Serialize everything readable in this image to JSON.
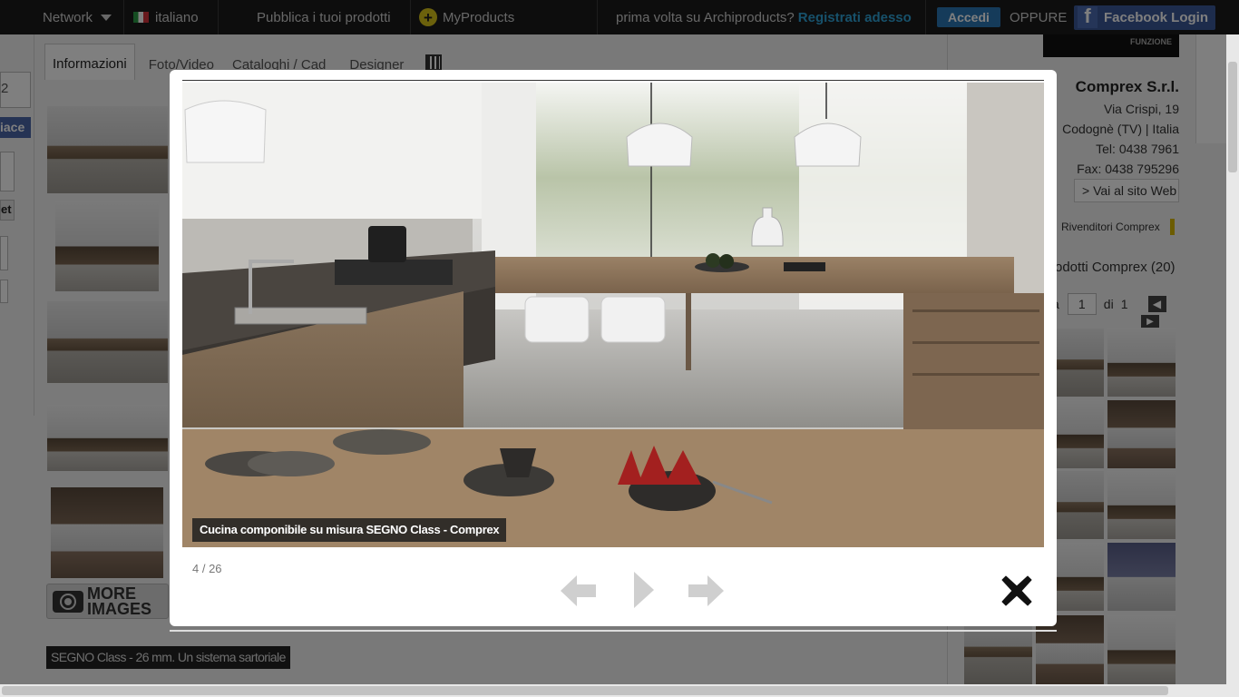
{
  "topbar": {
    "network": "Network",
    "language": "italiano",
    "publish": "Pubblica i tuoi prodotti",
    "myproducts": "MyProducts",
    "first_time": "prima volta su Archiproducts?",
    "register": "Registrati adesso",
    "login": "Accedi",
    "or": "OPPURE",
    "facebook": "Facebook Login"
  },
  "tabs": [
    "Informazioni",
    "Foto/Video",
    "Cataloghi / Cad",
    "Designer"
  ],
  "left_partial": {
    "field_value": "2",
    "like_button": "iace",
    "tweet_button": "et"
  },
  "more_images": [
    "MORE",
    "IMAGES"
  ],
  "caption_bar": "SEGNO Class - 26 mm. Un sistema sartoriale",
  "company": {
    "name": "Comprex S.r.l.",
    "street": "Via Crispi, 19",
    "city": "Codognè (TV) | Italia",
    "tel": "Tel: 0438 7961",
    "fax": "Fax: 0438 795296",
    "website": "> Vai al sito Web",
    "dealers": "Rivenditori Comprex",
    "products": "rodotti Comprex (20)",
    "page_label": "a",
    "page_value": "1",
    "page_of": "di",
    "page_total": "1"
  },
  "banner_text": "FUNZIONE",
  "lightbox": {
    "caption": "Cucina componibile su misura SEGNO Class - Comprex",
    "counter": "4 / 26"
  },
  "icons": {
    "prev": "arrow-left-icon",
    "play": "play-icon",
    "next": "arrow-right-icon",
    "close": "close-icon",
    "camera": "camera-icon",
    "qr": "qr-code-icon",
    "flag": "italy-flag-icon",
    "plus": "plus-circle-icon",
    "chevron": "chevron-down-icon",
    "facebook": "facebook-icon"
  },
  "colors": {
    "accent": "#2ea3d6",
    "login_bg": "#2a76b4",
    "facebook": "#3b5998",
    "topbar": "#1b1b1b"
  }
}
